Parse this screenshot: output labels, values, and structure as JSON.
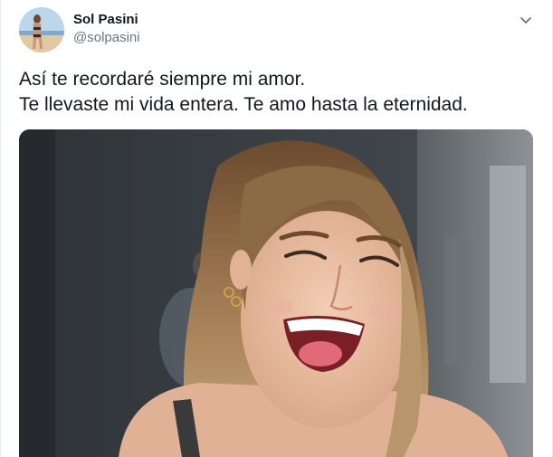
{
  "tweet": {
    "author_name": "Sol Pasini",
    "author_handle": "@solpasini",
    "text_lines": [
      "Así te recordaré siempre mi amor.",
      "Te llevaste mi vida entera. Te amo hasta la eternidad."
    ],
    "caret_icon": "chevron-down-icon",
    "avatar_icon": "profile-photo",
    "media_icon": "photo-laughing-woman"
  },
  "colors": {
    "text": "#14171a",
    "secondary": "#657786",
    "border": "#e6ecf0",
    "caret": "#657786"
  }
}
